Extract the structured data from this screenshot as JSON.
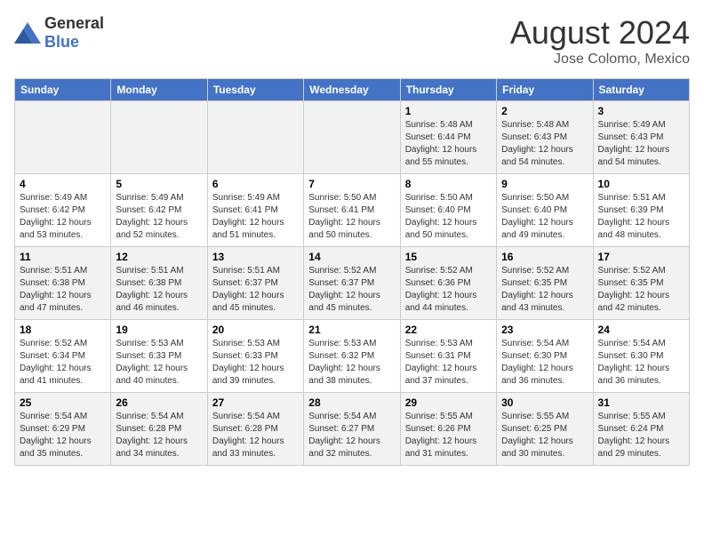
{
  "logo": {
    "general": "General",
    "blue": "Blue"
  },
  "title": "August 2024",
  "subtitle": "Jose Colomo, Mexico",
  "days_of_week": [
    "Sunday",
    "Monday",
    "Tuesday",
    "Wednesday",
    "Thursday",
    "Friday",
    "Saturday"
  ],
  "weeks": [
    [
      {
        "day": "",
        "info": ""
      },
      {
        "day": "",
        "info": ""
      },
      {
        "day": "",
        "info": ""
      },
      {
        "day": "",
        "info": ""
      },
      {
        "day": "1",
        "info": "Sunrise: 5:48 AM\nSunset: 6:44 PM\nDaylight: 12 hours\nand 55 minutes."
      },
      {
        "day": "2",
        "info": "Sunrise: 5:48 AM\nSunset: 6:43 PM\nDaylight: 12 hours\nand 54 minutes."
      },
      {
        "day": "3",
        "info": "Sunrise: 5:49 AM\nSunset: 6:43 PM\nDaylight: 12 hours\nand 54 minutes."
      }
    ],
    [
      {
        "day": "4",
        "info": "Sunrise: 5:49 AM\nSunset: 6:42 PM\nDaylight: 12 hours\nand 53 minutes."
      },
      {
        "day": "5",
        "info": "Sunrise: 5:49 AM\nSunset: 6:42 PM\nDaylight: 12 hours\nand 52 minutes."
      },
      {
        "day": "6",
        "info": "Sunrise: 5:49 AM\nSunset: 6:41 PM\nDaylight: 12 hours\nand 51 minutes."
      },
      {
        "day": "7",
        "info": "Sunrise: 5:50 AM\nSunset: 6:41 PM\nDaylight: 12 hours\nand 50 minutes."
      },
      {
        "day": "8",
        "info": "Sunrise: 5:50 AM\nSunset: 6:40 PM\nDaylight: 12 hours\nand 50 minutes."
      },
      {
        "day": "9",
        "info": "Sunrise: 5:50 AM\nSunset: 6:40 PM\nDaylight: 12 hours\nand 49 minutes."
      },
      {
        "day": "10",
        "info": "Sunrise: 5:51 AM\nSunset: 6:39 PM\nDaylight: 12 hours\nand 48 minutes."
      }
    ],
    [
      {
        "day": "11",
        "info": "Sunrise: 5:51 AM\nSunset: 6:38 PM\nDaylight: 12 hours\nand 47 minutes."
      },
      {
        "day": "12",
        "info": "Sunrise: 5:51 AM\nSunset: 6:38 PM\nDaylight: 12 hours\nand 46 minutes."
      },
      {
        "day": "13",
        "info": "Sunrise: 5:51 AM\nSunset: 6:37 PM\nDaylight: 12 hours\nand 45 minutes."
      },
      {
        "day": "14",
        "info": "Sunrise: 5:52 AM\nSunset: 6:37 PM\nDaylight: 12 hours\nand 45 minutes."
      },
      {
        "day": "15",
        "info": "Sunrise: 5:52 AM\nSunset: 6:36 PM\nDaylight: 12 hours\nand 44 minutes."
      },
      {
        "day": "16",
        "info": "Sunrise: 5:52 AM\nSunset: 6:35 PM\nDaylight: 12 hours\nand 43 minutes."
      },
      {
        "day": "17",
        "info": "Sunrise: 5:52 AM\nSunset: 6:35 PM\nDaylight: 12 hours\nand 42 minutes."
      }
    ],
    [
      {
        "day": "18",
        "info": "Sunrise: 5:52 AM\nSunset: 6:34 PM\nDaylight: 12 hours\nand 41 minutes."
      },
      {
        "day": "19",
        "info": "Sunrise: 5:53 AM\nSunset: 6:33 PM\nDaylight: 12 hours\nand 40 minutes."
      },
      {
        "day": "20",
        "info": "Sunrise: 5:53 AM\nSunset: 6:33 PM\nDaylight: 12 hours\nand 39 minutes."
      },
      {
        "day": "21",
        "info": "Sunrise: 5:53 AM\nSunset: 6:32 PM\nDaylight: 12 hours\nand 38 minutes."
      },
      {
        "day": "22",
        "info": "Sunrise: 5:53 AM\nSunset: 6:31 PM\nDaylight: 12 hours\nand 37 minutes."
      },
      {
        "day": "23",
        "info": "Sunrise: 5:54 AM\nSunset: 6:30 PM\nDaylight: 12 hours\nand 36 minutes."
      },
      {
        "day": "24",
        "info": "Sunrise: 5:54 AM\nSunset: 6:30 PM\nDaylight: 12 hours\nand 36 minutes."
      }
    ],
    [
      {
        "day": "25",
        "info": "Sunrise: 5:54 AM\nSunset: 6:29 PM\nDaylight: 12 hours\nand 35 minutes."
      },
      {
        "day": "26",
        "info": "Sunrise: 5:54 AM\nSunset: 6:28 PM\nDaylight: 12 hours\nand 34 minutes."
      },
      {
        "day": "27",
        "info": "Sunrise: 5:54 AM\nSunset: 6:28 PM\nDaylight: 12 hours\nand 33 minutes."
      },
      {
        "day": "28",
        "info": "Sunrise: 5:54 AM\nSunset: 6:27 PM\nDaylight: 12 hours\nand 32 minutes."
      },
      {
        "day": "29",
        "info": "Sunrise: 5:55 AM\nSunset: 6:26 PM\nDaylight: 12 hours\nand 31 minutes."
      },
      {
        "day": "30",
        "info": "Sunrise: 5:55 AM\nSunset: 6:25 PM\nDaylight: 12 hours\nand 30 minutes."
      },
      {
        "day": "31",
        "info": "Sunrise: 5:55 AM\nSunset: 6:24 PM\nDaylight: 12 hours\nand 29 minutes."
      }
    ]
  ]
}
